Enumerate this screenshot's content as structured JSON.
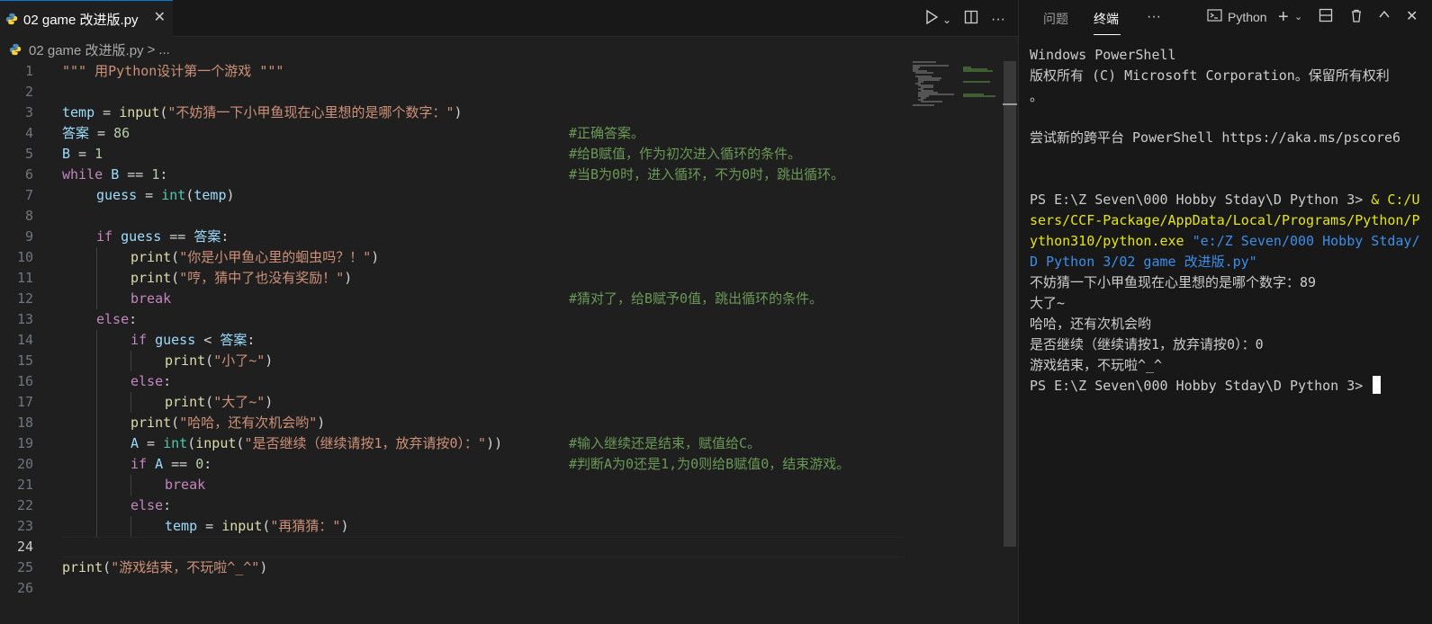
{
  "editor": {
    "tab_title": "02 game 改进版.py",
    "breadcrumb_file": "02 game 改进版.py",
    "breadcrumb_sep": ">",
    "breadcrumb_more": "...",
    "line_numbers": [
      "1",
      "2",
      "3",
      "4",
      "5",
      "6",
      "7",
      "8",
      "9",
      "10",
      "11",
      "12",
      "13",
      "14",
      "15",
      "16",
      "17",
      "18",
      "19",
      "20",
      "21",
      "22",
      "23",
      "24",
      "25",
      "26"
    ],
    "active_line": 24,
    "code_lines": [
      {
        "indent": 0,
        "tokens": [
          [
            "s",
            "\"\"\" 用Python设计第一个游戏 \"\"\""
          ]
        ]
      },
      {
        "indent": 0,
        "tokens": []
      },
      {
        "indent": 0,
        "tokens": [
          [
            "v",
            "temp"
          ],
          [
            "o",
            " = "
          ],
          [
            "f",
            "input"
          ],
          [
            "o",
            "("
          ],
          [
            "s",
            "\"不妨猜一下小甲鱼现在心里想的是哪个数字：\""
          ],
          [
            "o",
            ")"
          ]
        ]
      },
      {
        "indent": 0,
        "tokens": [
          [
            "v",
            "答案"
          ],
          [
            "o",
            " = "
          ],
          [
            "n",
            "86"
          ]
        ],
        "comment": "#正确答案。"
      },
      {
        "indent": 0,
        "tokens": [
          [
            "v",
            "B"
          ],
          [
            "o",
            " = "
          ],
          [
            "n",
            "1"
          ]
        ],
        "comment": "#给B赋值，作为初次进入循环的条件。"
      },
      {
        "indent": 0,
        "tokens": [
          [
            "k",
            "while"
          ],
          [
            "o",
            " "
          ],
          [
            "v",
            "B"
          ],
          [
            "o",
            " == "
          ],
          [
            "n",
            "1"
          ],
          [
            "o",
            ":"
          ]
        ],
        "comment": "#当B为0时，进入循环，不为0时，跳出循环。"
      },
      {
        "indent": 1,
        "tokens": [
          [
            "v",
            "guess"
          ],
          [
            "o",
            " = "
          ],
          [
            "b",
            "int"
          ],
          [
            "o",
            "("
          ],
          [
            "v",
            "temp"
          ],
          [
            "o",
            ")"
          ]
        ]
      },
      {
        "indent": 0,
        "tokens": []
      },
      {
        "indent": 1,
        "tokens": [
          [
            "k",
            "if"
          ],
          [
            "o",
            " "
          ],
          [
            "v",
            "guess"
          ],
          [
            "o",
            " == "
          ],
          [
            "v",
            "答案"
          ],
          [
            "o",
            ":"
          ]
        ]
      },
      {
        "indent": 2,
        "tokens": [
          [
            "f",
            "print"
          ],
          [
            "o",
            "("
          ],
          [
            "s",
            "\"你是小甲鱼心里的蛔虫吗？！\""
          ],
          [
            "o",
            ")"
          ]
        ]
      },
      {
        "indent": 2,
        "tokens": [
          [
            "f",
            "print"
          ],
          [
            "o",
            "("
          ],
          [
            "s",
            "\"哼，猜中了也没有奖励！\""
          ],
          [
            "o",
            ")"
          ]
        ]
      },
      {
        "indent": 2,
        "tokens": [
          [
            "k",
            "break"
          ]
        ],
        "comment": "#猜对了，给B赋予0值，跳出循环的条件。"
      },
      {
        "indent": 1,
        "tokens": [
          [
            "k",
            "else"
          ],
          [
            "o",
            ":"
          ]
        ]
      },
      {
        "indent": 2,
        "tokens": [
          [
            "k",
            "if"
          ],
          [
            "o",
            " "
          ],
          [
            "v",
            "guess"
          ],
          [
            "o",
            " < "
          ],
          [
            "v",
            "答案"
          ],
          [
            "o",
            ":"
          ]
        ]
      },
      {
        "indent": 3,
        "tokens": [
          [
            "f",
            "print"
          ],
          [
            "o",
            "("
          ],
          [
            "s",
            "\"小了~\""
          ],
          [
            "o",
            ")"
          ]
        ]
      },
      {
        "indent": 2,
        "tokens": [
          [
            "k",
            "else"
          ],
          [
            "o",
            ":"
          ]
        ]
      },
      {
        "indent": 3,
        "tokens": [
          [
            "f",
            "print"
          ],
          [
            "o",
            "("
          ],
          [
            "s",
            "\"大了~\""
          ],
          [
            "o",
            ")"
          ]
        ]
      },
      {
        "indent": 2,
        "tokens": [
          [
            "f",
            "print"
          ],
          [
            "o",
            "("
          ],
          [
            "s",
            "\"哈哈，还有次机会哟\""
          ],
          [
            "o",
            ")"
          ]
        ]
      },
      {
        "indent": 2,
        "tokens": [
          [
            "v",
            "A"
          ],
          [
            "o",
            " = "
          ],
          [
            "b",
            "int"
          ],
          [
            "o",
            "("
          ],
          [
            "f",
            "input"
          ],
          [
            "o",
            "("
          ],
          [
            "s",
            "\"是否继续（继续请按1，放弃请按0）：\""
          ],
          [
            "o",
            "))"
          ]
        ],
        "comment": "#输入继续还是结束，赋值给C。"
      },
      {
        "indent": 2,
        "tokens": [
          [
            "k",
            "if"
          ],
          [
            "o",
            " "
          ],
          [
            "v",
            "A"
          ],
          [
            "o",
            " == "
          ],
          [
            "n",
            "0"
          ],
          [
            "o",
            ":"
          ]
        ],
        "comment": "#判断A为0还是1,为0则给B赋值0，结束游戏。"
      },
      {
        "indent": 3,
        "tokens": [
          [
            "k",
            "break"
          ]
        ]
      },
      {
        "indent": 2,
        "tokens": [
          [
            "k",
            "else"
          ],
          [
            "o",
            ":"
          ]
        ]
      },
      {
        "indent": 3,
        "tokens": [
          [
            "v",
            "temp"
          ],
          [
            "o",
            " = "
          ],
          [
            "f",
            "input"
          ],
          [
            "o",
            "("
          ],
          [
            "s",
            "\"再猜猜：\""
          ],
          [
            "o",
            ")"
          ]
        ]
      },
      {
        "indent": 0,
        "tokens": []
      },
      {
        "indent": 0,
        "tokens": [
          [
            "f",
            "print"
          ],
          [
            "o",
            "("
          ],
          [
            "s",
            "\"游戏结束，不玩啦^_^\""
          ],
          [
            "o",
            ")"
          ]
        ]
      },
      {
        "indent": 0,
        "tokens": []
      }
    ]
  },
  "panel": {
    "tabs": [
      "问题",
      "终端"
    ],
    "active_tab": "终端",
    "more": "···",
    "terminal_profile": "Python"
  },
  "terminal": {
    "lines": [
      [
        [
          "",
          "Windows PowerShell"
        ]
      ],
      [
        [
          "",
          "版权所有 (C) Microsoft Corporation。保留所有权利"
        ]
      ],
      [
        [
          "",
          "。"
        ]
      ],
      [],
      [
        [
          "",
          "尝试新的跨平台 PowerShell https://aka.ms/pscore6"
        ]
      ],
      [],
      [],
      [
        [
          "",
          "PS E:\\Z Seven\\000 Hobby Stday\\D Python 3> "
        ],
        [
          "t-yellow",
          "& C:/U"
        ]
      ],
      [
        [
          "t-yellow",
          "sers/CCF-Package/AppData/Local/Programs/Python/P"
        ]
      ],
      [
        [
          "t-yellow",
          "ython310/python.exe "
        ],
        [
          "t-blue",
          "\"e:/Z Seven/000 Hobby Stday/"
        ]
      ],
      [
        [
          "t-blue",
          "D Python 3/02 game 改进版.py\""
        ]
      ],
      [
        [
          "",
          "不妨猜一下小甲鱼现在心里想的是哪个数字：89"
        ]
      ],
      [
        [
          "",
          "大了~"
        ]
      ],
      [
        [
          "",
          "哈哈，还有次机会哟"
        ]
      ],
      [
        [
          "",
          "是否继续（继续请按1，放弃请按0）：0"
        ]
      ],
      [
        [
          "",
          "游戏结束，不玩啦^_^"
        ]
      ],
      [
        [
          "",
          "PS E:\\Z Seven\\000 Hobby Stday\\D Python 3> "
        ]
      ]
    ]
  },
  "colors": {
    "editor_bg": "#1f1f1f",
    "keyword": "#c586c0",
    "variable": "#9cdcfe",
    "function": "#dcdcaa",
    "builtin": "#4ec9b0",
    "string": "#ce9178",
    "number": "#b5cea8",
    "comment": "#6a9955",
    "accent": "#0078d4"
  },
  "icons": {
    "tab_file": "python-file-icon",
    "run": "run-icon",
    "split": "split-editor-icon",
    "more": "more-actions-icon",
    "terminal": "terminal-icon",
    "add": "add-terminal-icon",
    "trash": "trash-icon",
    "maximize": "maximize-panel-icon"
  }
}
